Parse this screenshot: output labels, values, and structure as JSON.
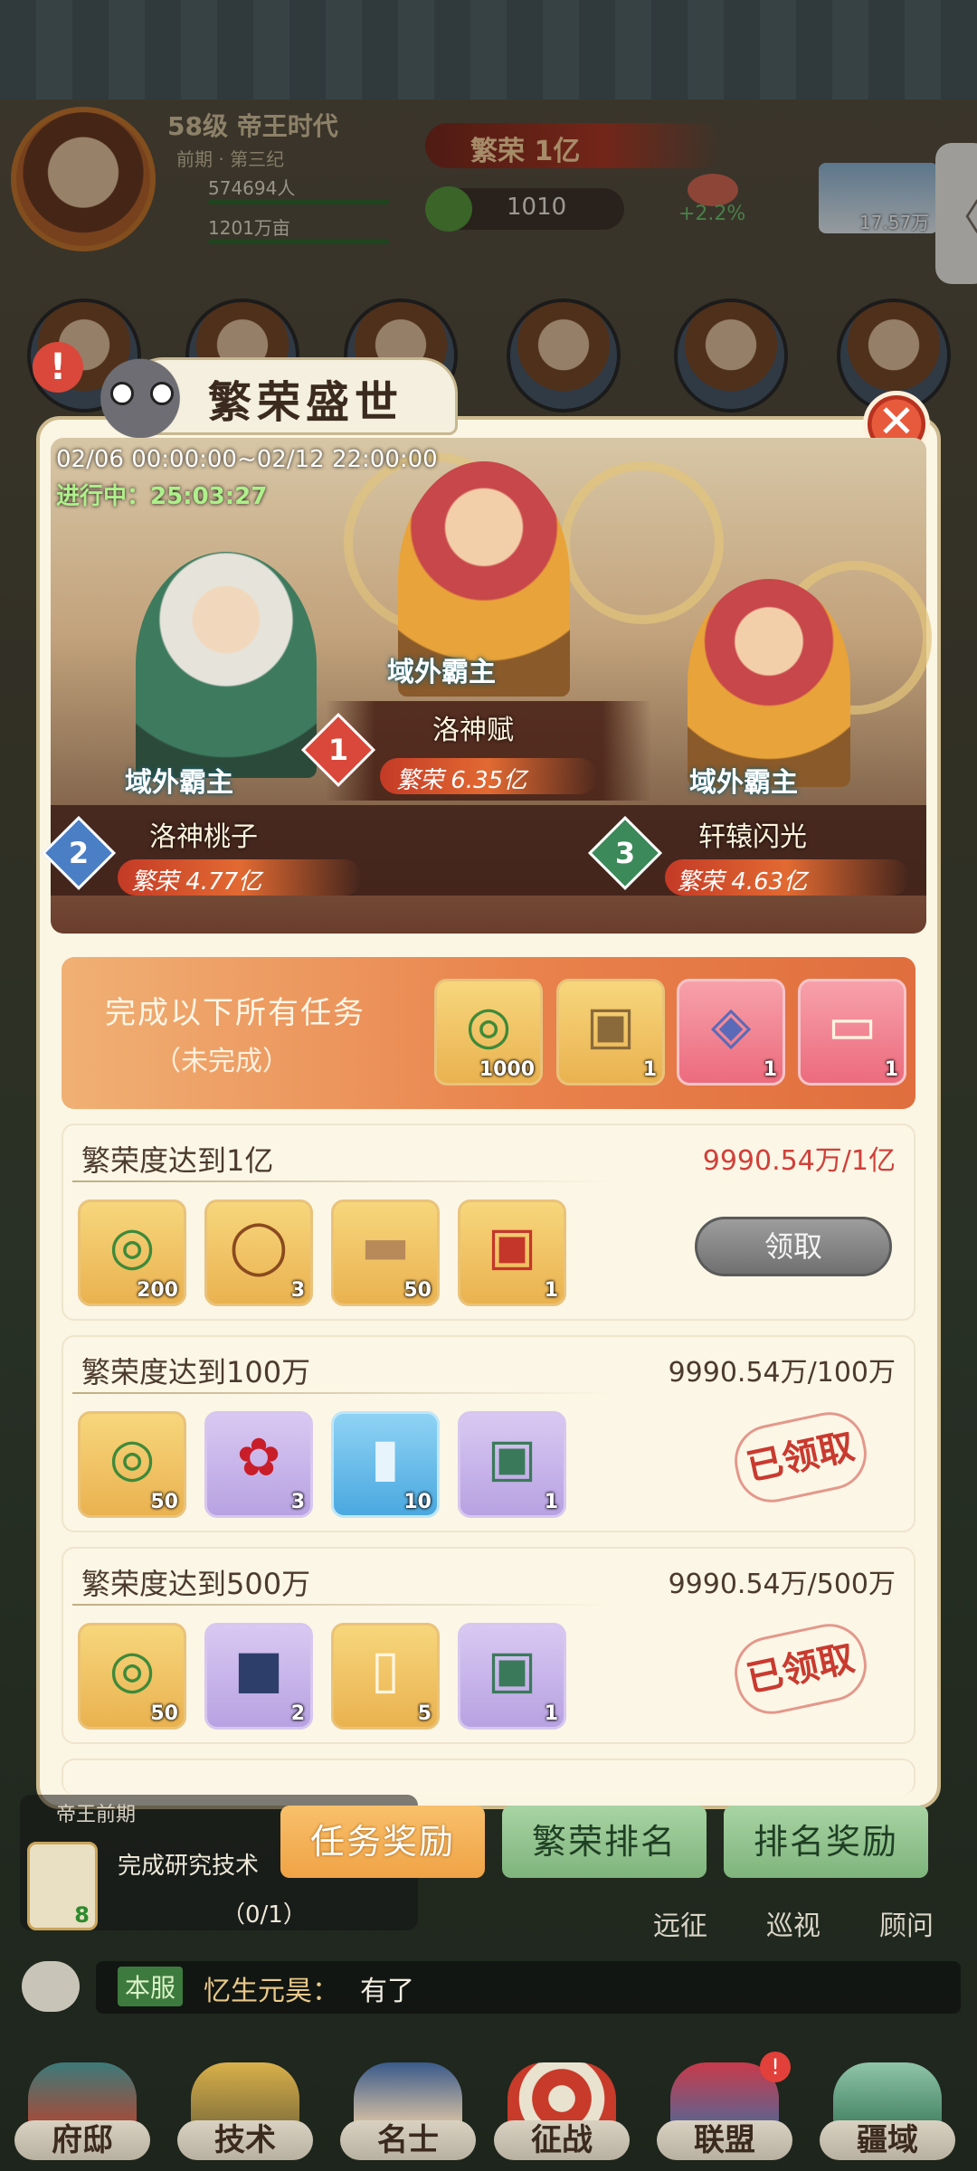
{
  "header": {
    "level": "58级",
    "era_name": "帝王时代",
    "era_period": "前期 · 第三纪",
    "population": "574694人",
    "land": "1201万亩",
    "prosperity": "繁荣 1亿",
    "jade": "1010",
    "growth": "+2.2%",
    "side_value": "17.57万",
    "side_tab_glyph": "〈"
  },
  "modal": {
    "title": "繁荣盛世",
    "close_glyph": "✕",
    "date_range": "02/06 00:00:00~02/12 22:00:00",
    "status": "进行中：25:03:27",
    "rankings": [
      {
        "rank": "1",
        "name": "洛神赋",
        "prosperity": "繁荣 6.35亿",
        "title": "域外霸主"
      },
      {
        "rank": "2",
        "name": "洛神桃子",
        "prosperity": "繁荣 4.77亿",
        "title": "域外霸主"
      },
      {
        "rank": "3",
        "name": "轩辕闪光",
        "prosperity": "繁荣 4.63亿",
        "title": "域外霸主"
      }
    ],
    "complete_all": {
      "title": "完成以下所有任务",
      "status": "（未完成）",
      "rewards": [
        {
          "icon": "jade-dragon-icon",
          "qty": "1000",
          "style": "gold"
        },
        {
          "icon": "treasure-chest-icon",
          "qty": "1",
          "style": "gold"
        },
        {
          "icon": "ornate-chest-icon",
          "qty": "1",
          "style": "pink"
        },
        {
          "icon": "scroll-icon",
          "qty": "1",
          "style": "pink"
        }
      ]
    },
    "tasks": [
      {
        "name": "繁荣度达到1亿",
        "progress": "9990.54万/1亿",
        "action": "领取",
        "rewards": [
          {
            "icon": "jade-dragon-icon",
            "qty": "200",
            "style": "gold"
          },
          {
            "icon": "rope-icon",
            "qty": "3",
            "style": "gold"
          },
          {
            "icon": "log-icon",
            "qty": "50",
            "style": "gold"
          },
          {
            "icon": "red-chest-icon",
            "qty": "1",
            "style": "gold"
          }
        ]
      },
      {
        "name": "繁荣度达到100万",
        "progress": "9990.54万/100万",
        "action": "已领取",
        "rewards": [
          {
            "icon": "jade-dragon-icon",
            "qty": "50",
            "style": "gold"
          },
          {
            "icon": "rose-icon",
            "qty": "3",
            "style": "purple"
          },
          {
            "icon": "card-icon",
            "qty": "10",
            "style": "blue"
          },
          {
            "icon": "green-chest-icon",
            "qty": "1",
            "style": "purple"
          }
        ]
      },
      {
        "name": "繁荣度达到500万",
        "progress": "9990.54万/500万",
        "action": "已领取",
        "rewards": [
          {
            "icon": "jade-dragon-icon",
            "qty": "50",
            "style": "gold"
          },
          {
            "icon": "blue-box-icon",
            "qty": "2",
            "style": "purple"
          },
          {
            "icon": "tile-icon",
            "qty": "5",
            "style": "gold"
          },
          {
            "icon": "green-chest-icon",
            "qty": "1",
            "style": "purple"
          }
        ]
      }
    ],
    "tabs": [
      {
        "label": "任务奖励",
        "active": true
      },
      {
        "label": "繁荣排名",
        "active": false
      },
      {
        "label": "排名奖励",
        "active": false
      }
    ]
  },
  "quest": {
    "header": "帝王前期",
    "text": "完成研究技术",
    "progress": "（0/1）",
    "item_qty": "8"
  },
  "mini_actions": [
    "远征",
    "巡视",
    "顾问"
  ],
  "chat": {
    "tag": "本服",
    "user": "忆生元昊：",
    "message": "有了"
  },
  "nav": [
    "府邸",
    "技术",
    "名士",
    "征战",
    "联盟",
    "疆域"
  ]
}
